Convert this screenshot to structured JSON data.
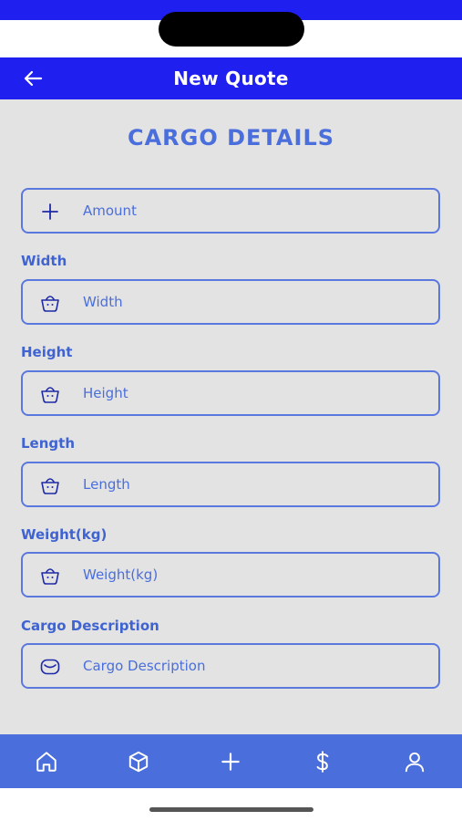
{
  "app_bar": {
    "title": "New Quote"
  },
  "section": {
    "title": "CARGO DETAILS"
  },
  "fields": {
    "amount": {
      "placeholder": "Amount",
      "icon": "plus-icon"
    },
    "width": {
      "label": "Width",
      "placeholder": "Width",
      "icon": "basket-icon"
    },
    "height": {
      "label": "Height",
      "placeholder": "Height",
      "icon": "basket-icon"
    },
    "length": {
      "label": "Length",
      "placeholder": "Length",
      "icon": "basket-icon"
    },
    "weight": {
      "label": "Weight(kg)",
      "placeholder": "Weight(kg)",
      "icon": "basket-icon"
    },
    "description": {
      "label": "Cargo Description",
      "placeholder": "Cargo Description",
      "icon": "envelope-icon"
    }
  },
  "bottom_nav": {
    "items": [
      "home-icon",
      "box-icon",
      "plus-icon",
      "dollar-icon",
      "user-icon"
    ]
  },
  "colors": {
    "primary_blue": "#1f1ff0",
    "accent_blue": "#4a6edb",
    "background": "#e3e3e3"
  }
}
